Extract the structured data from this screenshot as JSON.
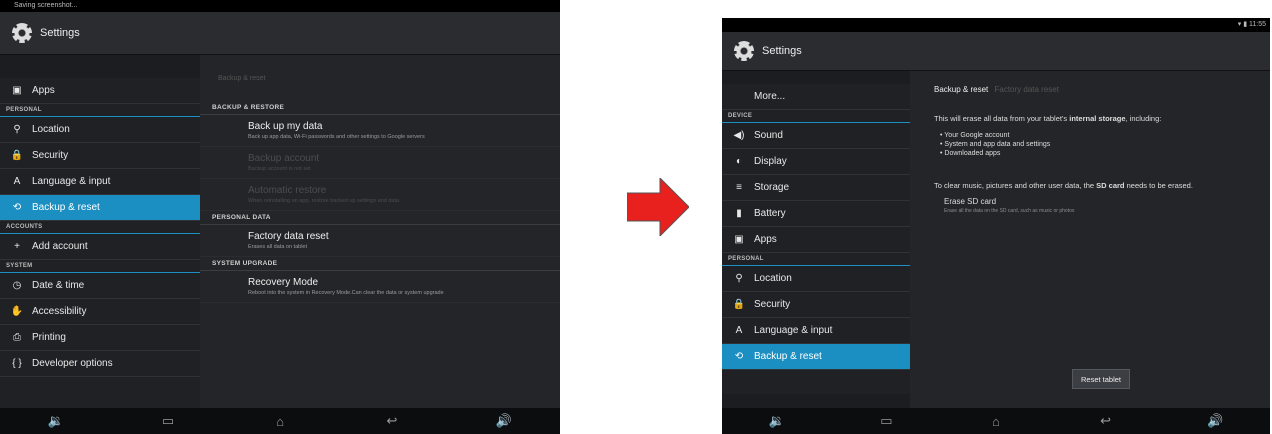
{
  "left": {
    "status_text": "Saving screenshot...",
    "title": "Settings",
    "sidebar": [
      {
        "kind": "item",
        "icon": "apps-icon",
        "glyph": "▣",
        "label": "Apps"
      },
      {
        "kind": "header",
        "label": "PERSONAL"
      },
      {
        "kind": "item",
        "icon": "location-icon",
        "glyph": "⚲",
        "label": "Location"
      },
      {
        "kind": "item",
        "icon": "lock-icon",
        "glyph": "🔒",
        "label": "Security"
      },
      {
        "kind": "item",
        "icon": "language-icon",
        "glyph": "A",
        "label": "Language & input"
      },
      {
        "kind": "item",
        "icon": "backup-icon",
        "glyph": "⟲",
        "label": "Backup & reset",
        "active": true
      },
      {
        "kind": "header",
        "label": "ACCOUNTS"
      },
      {
        "kind": "item",
        "icon": "plus-icon",
        "glyph": "+",
        "label": "Add account"
      },
      {
        "kind": "header",
        "label": "SYSTEM"
      },
      {
        "kind": "item",
        "icon": "clock-icon",
        "glyph": "◷",
        "label": "Date & time"
      },
      {
        "kind": "item",
        "icon": "hand-icon",
        "glyph": "✋",
        "label": "Accessibility"
      },
      {
        "kind": "item",
        "icon": "printer-icon",
        "glyph": "⎙",
        "label": "Printing"
      },
      {
        "kind": "item",
        "icon": "braces-icon",
        "glyph": "{ }",
        "label": "Developer options"
      }
    ],
    "content_title": "Backup & reset",
    "sections": [
      {
        "header": "BACKUP & RESTORE",
        "prefs": [
          {
            "title": "Back up my data",
            "summary": "Back up app data, Wi-Fi passwords and other settings to Google servers",
            "enabled": true
          },
          {
            "title": "Backup account",
            "summary": "Backup account is not set",
            "enabled": false
          },
          {
            "title": "Automatic restore",
            "summary": "When reinstalling an app, restore backed up settings and data",
            "enabled": false
          }
        ]
      },
      {
        "header": "PERSONAL DATA",
        "prefs": [
          {
            "title": "Factory data reset",
            "summary": "Erases all data on tablet",
            "enabled": true
          }
        ]
      },
      {
        "header": "SYSTEM UPGRADE",
        "prefs": [
          {
            "title": "Recovery Mode",
            "summary": "Reboot into the system in Recovery Mode.Can clear the data or system upgrade",
            "enabled": true
          }
        ]
      }
    ],
    "nav": [
      "🔉",
      "▭",
      "⌂",
      "↩",
      "🔊"
    ]
  },
  "right": {
    "status_text": "11:55",
    "title": "Settings",
    "sidebar": [
      {
        "kind": "item",
        "icon": "more-icon",
        "glyph": "",
        "label": "More..."
      },
      {
        "kind": "header",
        "label": "DEVICE"
      },
      {
        "kind": "item",
        "icon": "sound-icon",
        "glyph": "◀)",
        "label": "Sound"
      },
      {
        "kind": "item",
        "icon": "display-icon",
        "glyph": "◐",
        "label": "Display"
      },
      {
        "kind": "item",
        "icon": "storage-icon",
        "glyph": "≡",
        "label": "Storage"
      },
      {
        "kind": "item",
        "icon": "battery-icon",
        "glyph": "▮",
        "label": "Battery"
      },
      {
        "kind": "item",
        "icon": "apps-icon",
        "glyph": "▣",
        "label": "Apps"
      },
      {
        "kind": "header",
        "label": "PERSONAL"
      },
      {
        "kind": "item",
        "icon": "location-icon",
        "glyph": "⚲",
        "label": "Location"
      },
      {
        "kind": "item",
        "icon": "lock-icon",
        "glyph": "🔒",
        "label": "Security"
      },
      {
        "kind": "item",
        "icon": "language-icon",
        "glyph": "A",
        "label": "Language & input"
      },
      {
        "kind": "item",
        "icon": "backup-icon",
        "glyph": "⟲",
        "label": "Backup & reset",
        "active": true
      }
    ],
    "breadcrumb_main": "Backup & reset",
    "breadcrumb_sub": "Factory data reset",
    "intro_pre": "This will erase all data from your tablet's ",
    "intro_bold": "internal storage",
    "intro_post": ", including:",
    "bullets": [
      "Your Google account",
      "System and app data and settings",
      "Downloaded apps"
    ],
    "sd_pre": "To clear music, pictures and other user data, the ",
    "sd_bold": "SD card",
    "sd_post": " needs to be erased.",
    "erase_title": "Erase SD card",
    "erase_sum": "Erase all the data on the SD card, such as music or photos",
    "reset_button": "Reset tablet",
    "nav": [
      "🔉",
      "▭",
      "⌂",
      "↩",
      "🔊"
    ]
  },
  "arrow_color": "#e8201e"
}
